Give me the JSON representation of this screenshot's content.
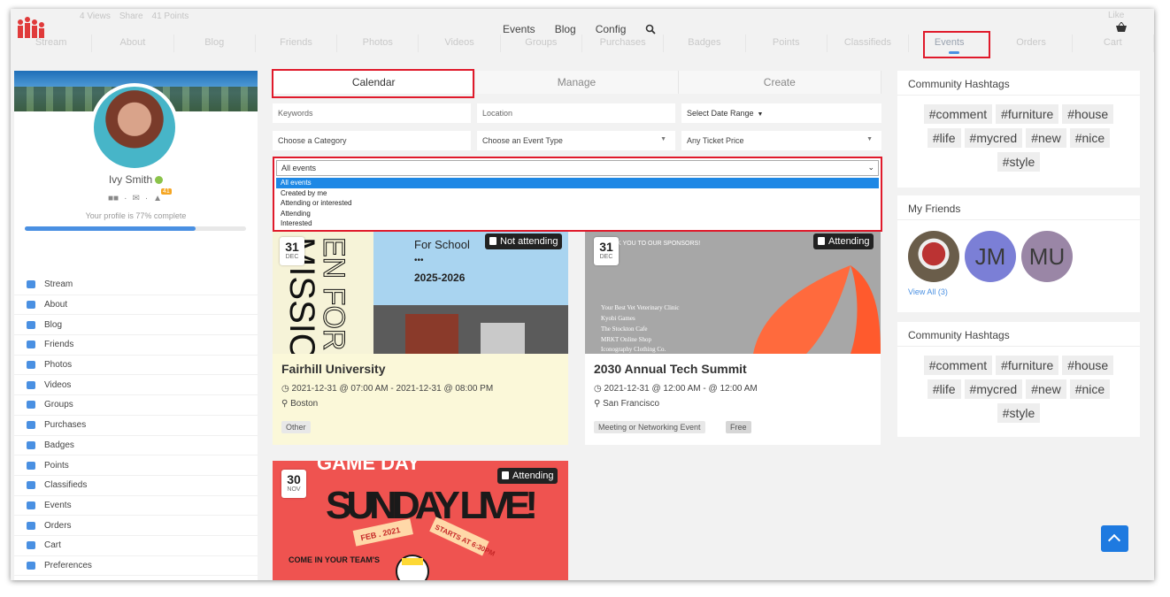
{
  "header": {
    "stats": {
      "views": "4 Views",
      "share": "Share",
      "points": "41 Points"
    },
    "nav": [
      "Events",
      "Blog",
      "Config"
    ],
    "like": "Like",
    "ghost_nav": [
      "Stream",
      "About",
      "Blog",
      "Friends",
      "Photos",
      "Videos",
      "Groups",
      "Purchases",
      "Badges",
      "Points",
      "Classifieds",
      "Events",
      "Orders",
      "Cart"
    ]
  },
  "profile": {
    "name": "Ivy Smith",
    "notifications": "41",
    "completion_text": "Your profile is 77% complete",
    "completion": 0.77
  },
  "menu": [
    "Stream",
    "About",
    "Blog",
    "Friends",
    "Photos",
    "Videos",
    "Groups",
    "Purchases",
    "Badges",
    "Points",
    "Classifieds",
    "Events",
    "Orders",
    "Cart",
    "Preferences"
  ],
  "tabs": [
    "Calendar",
    "Manage",
    "Create"
  ],
  "filters": {
    "keywords": "Keywords",
    "location": "Location",
    "date_range": "Select Date Range",
    "category": "Choose a Category",
    "event_type": "Choose an Event Type",
    "ticket_price": "Any Ticket Price"
  },
  "event_filter": {
    "selected": "All events",
    "options": [
      "All events",
      "Created by me",
      "Attending or interested",
      "Attending",
      "Interested"
    ]
  },
  "events": [
    {
      "day": "31",
      "month": "DEC",
      "status": "Not attending",
      "image_text": [
        "For School",
        "2025-2026"
      ],
      "title": "Fairhill University",
      "time": "2021-12-31 @ 07:00 AM - 2021-12-31 @ 08:00 PM",
      "location": "Boston",
      "tags": [
        "Other"
      ]
    },
    {
      "day": "31",
      "month": "DEC",
      "status": "Attending",
      "image_text": [
        "K YOU TO OUR SPONSORS!",
        "Your Best Vet Veterinary Clinic",
        "Kyobi Games",
        "The Stockton Cafe",
        "MRKT Online Shop",
        "Iconography Clothing Co."
      ],
      "title": "2030 Annual Tech Summit",
      "time": "2021-12-31 @ 12:00 AM - @ 12:00 AM",
      "location": "San Francisco",
      "tags": [
        "Meeting or Networking Event",
        "Free"
      ]
    },
    {
      "day": "30",
      "month": "NOV",
      "status": "Attending",
      "image_text": [
        "GAME DAY",
        "SUNDAY LIVE!",
        "FEB . 2021",
        "STARTS AT 6:30PM",
        "COME IN YOUR TEAM'S"
      ]
    }
  ],
  "hashtags": {
    "title": "Community Hashtags",
    "tags": [
      "#comment",
      "#furniture",
      "#house",
      "#life",
      "#mycred",
      "#new",
      "#nice",
      "#style"
    ]
  },
  "friends": {
    "title": "My Friends",
    "initials": [
      "JM",
      "MU"
    ],
    "view_all": "View All (3)"
  },
  "colors": {
    "accent": "#4a90e2",
    "highlight": "#e01a2b",
    "selected_option": "#1e88e5"
  }
}
